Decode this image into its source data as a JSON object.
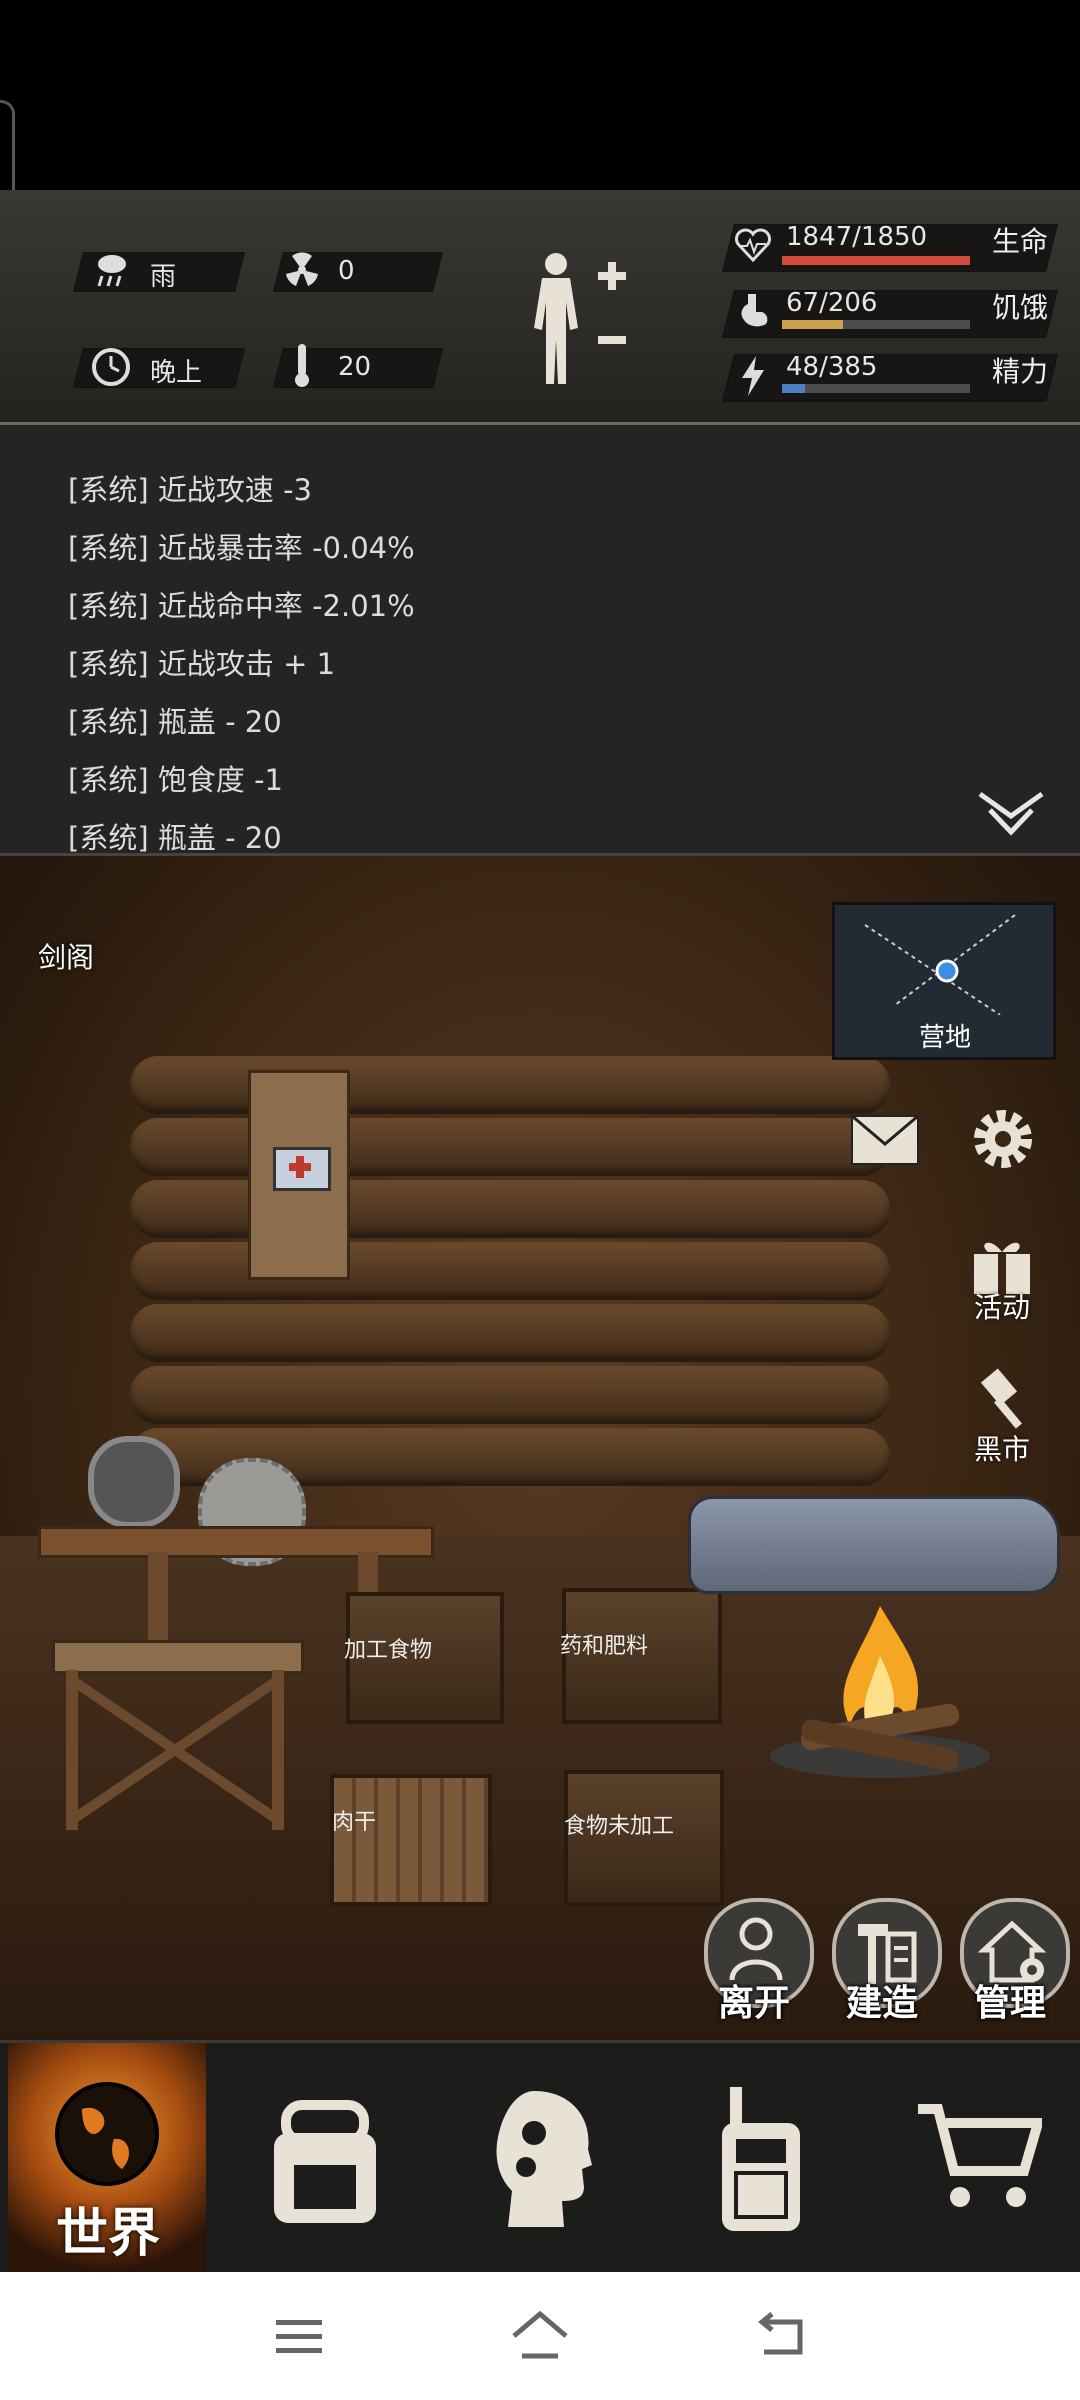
{
  "status": {
    "weather": "雨",
    "radiation": "0",
    "time_of_day": "晚上",
    "temperature": "20",
    "stats": [
      {
        "label": "生命",
        "value": "1847/1850",
        "current": 1847,
        "max": 1850,
        "color": "#d24a3a"
      },
      {
        "label": "饥饿",
        "value": "67/206",
        "current": 67,
        "max": 206,
        "color": "#c9a24a"
      },
      {
        "label": "精力",
        "value": "48/385",
        "current": 48,
        "max": 385,
        "color": "#4b7fbf"
      }
    ]
  },
  "log": {
    "lines": [
      "[系统] 近战攻速 -3",
      "[系统] 近战暴击率 -0.04%",
      "[系统] 近战命中率 -2.01%",
      "[系统] 近战攻击 + 1",
      "[系统] 瓶盖 - 20",
      "[系统] 饱食度 -1",
      "[系统] 瓶盖 - 20"
    ]
  },
  "scene": {
    "location_name": "剑阁",
    "map_label": "营地",
    "side_buttons": {
      "activity": "活动",
      "black_market": "黑市"
    },
    "crates": {
      "processed_food": "加工食物",
      "medicine_fertilizer": "药和肥料",
      "jerky": "肉干",
      "raw_food": "食物未加工"
    },
    "actions": {
      "leave": "离开",
      "build": "建造",
      "manage": "管理"
    }
  },
  "nav": {
    "world": "世界"
  },
  "icons": {
    "weather": "rain-cloud-icon",
    "radiation": "radiation-icon",
    "clock": "clock-icon",
    "thermometer": "thermometer-icon",
    "health": "heart-icon",
    "hunger": "stomach-icon",
    "energy": "lightning-icon"
  }
}
